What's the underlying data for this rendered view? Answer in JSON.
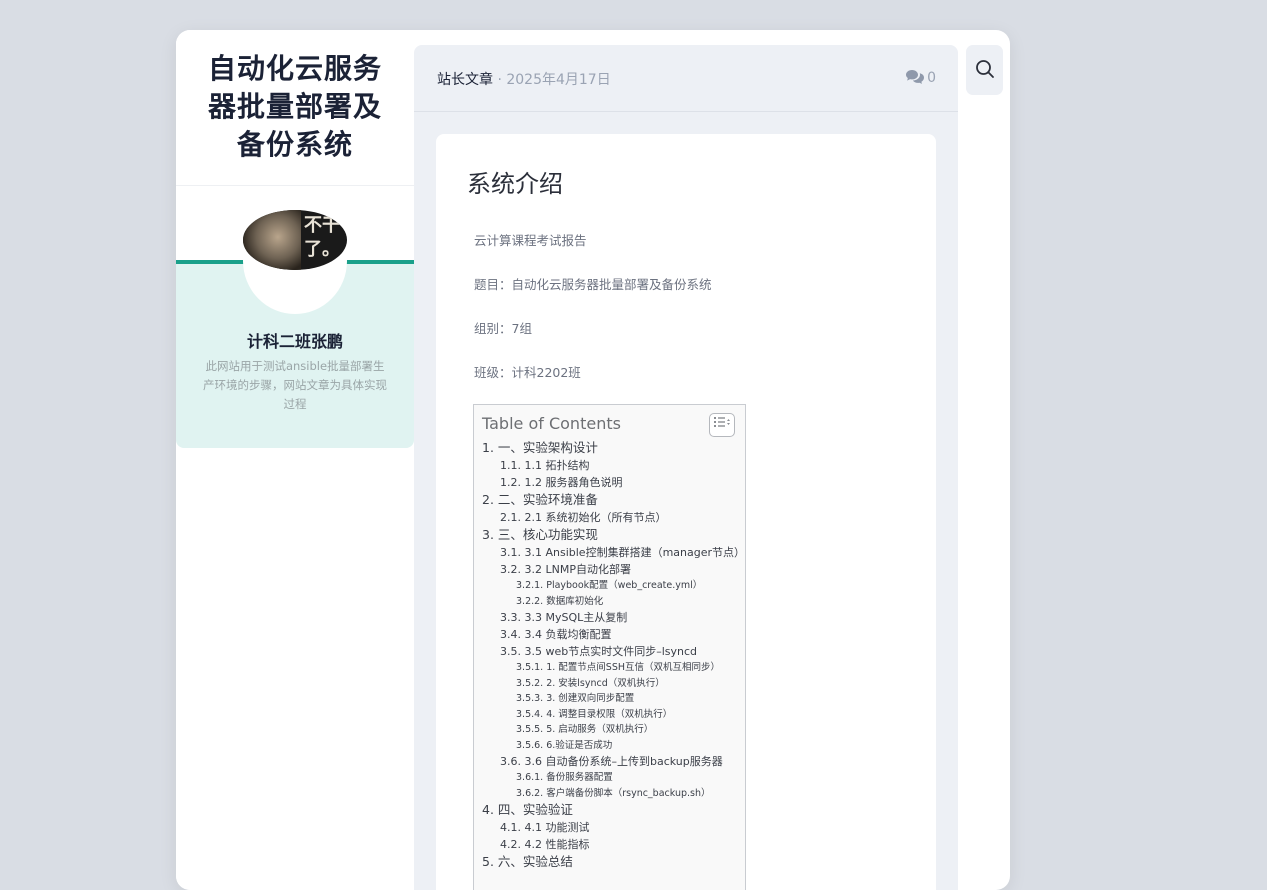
{
  "site": {
    "title_lines": [
      "自动化云服务",
      "器批量部署及",
      "备份系统"
    ]
  },
  "profile": {
    "name": "计科二班张鹏",
    "avatar_text": "不干了。",
    "description": "此网站用于测试ansible批量部署生产环境的步骤，网站文章为具体实现过程"
  },
  "meta": {
    "author": "站长文章",
    "separator": " · ",
    "date": "2025年4月17日",
    "comments_icon": "comments-icon",
    "comment_count": "0"
  },
  "article": {
    "heading": "系统介绍",
    "paragraphs": [
      "云计算课程考试报告",
      "题目：自动化云服务器批量部署及备份系统",
      "组别：7组",
      "班级：计科2202班"
    ]
  },
  "toc": {
    "title": "Table of Contents",
    "toggle_icon": "list-toggle-icon",
    "items": [
      {
        "level": 1,
        "text": "1. 一、实验架构设计"
      },
      {
        "level": 2,
        "text": "1.1. 1.1 拓扑结构"
      },
      {
        "level": 2,
        "text": "1.2. 1.2 服务器角色说明"
      },
      {
        "level": 1,
        "text": "2. 二、实验环境准备"
      },
      {
        "level": 2,
        "text": "2.1. 2.1 系统初始化（所有节点）"
      },
      {
        "level": 1,
        "text": "3. 三、核心功能实现"
      },
      {
        "level": 2,
        "text": "3.1. 3.1 Ansible控制集群搭建（manager节点）"
      },
      {
        "level": 2,
        "text": "3.2. 3.2 LNMP自动化部署"
      },
      {
        "level": 3,
        "text": "3.2.1. Playbook配置（web_create.yml）"
      },
      {
        "level": 3,
        "text": "3.2.2. 数据库初始化"
      },
      {
        "level": 2,
        "text": "3.3. 3.3 MySQL主从复制"
      },
      {
        "level": 2,
        "text": "3.4. 3.4 负载均衡配置"
      },
      {
        "level": 2,
        "text": "3.5. 3.5 web节点实时文件同步–lsyncd"
      },
      {
        "level": 3,
        "text": "3.5.1. 1. 配置节点间SSH互信（双机互相同步）"
      },
      {
        "level": 3,
        "text": "3.5.2. 2. 安装lsyncd（双机执行）"
      },
      {
        "level": 3,
        "text": "3.5.3. 3. 创建双向同步配置"
      },
      {
        "level": 3,
        "text": "3.5.4. 4. 调整目录权限（双机执行）"
      },
      {
        "level": 3,
        "text": "3.5.5. 5. 启动服务（双机执行）"
      },
      {
        "level": 3,
        "text": "3.5.6. 6.验证是否成功"
      },
      {
        "level": 2,
        "text": "3.6. 3.6 自动备份系统–上传到backup服务器"
      },
      {
        "level": 3,
        "text": "3.6.1. 备份服务器配置"
      },
      {
        "level": 3,
        "text": "3.6.2. 客户端备份脚本（rsync_backup.sh）"
      },
      {
        "level": 1,
        "text": "4. 四、实验验证"
      },
      {
        "level": 2,
        "text": "4.1. 4.1 功能测试"
      },
      {
        "level": 2,
        "text": "4.2. 4.2 性能指标"
      },
      {
        "level": 1,
        "text": "5. 六、实验总结"
      }
    ]
  },
  "search": {
    "icon": "search-icon"
  },
  "colors": {
    "accent": "#1aa08a",
    "profile_bg": "#e0f3f1",
    "page_bg": "#d9dde4",
    "main_bg": "#edf0f5"
  }
}
